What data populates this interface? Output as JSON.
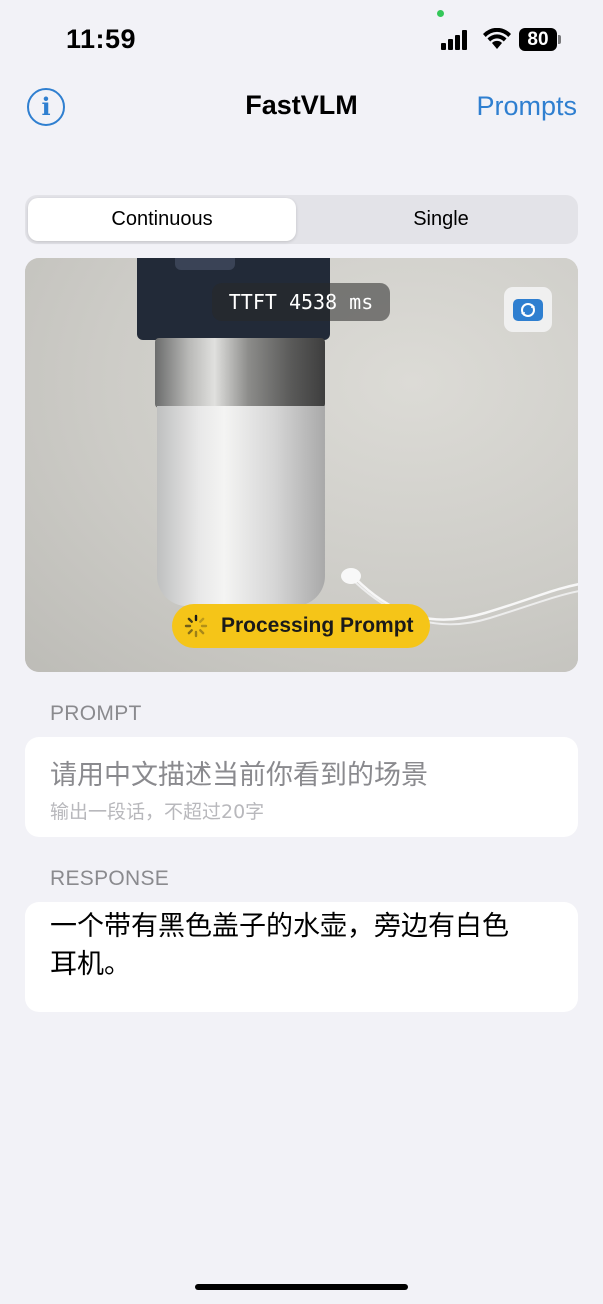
{
  "status_bar": {
    "time": "11:59",
    "battery": "80"
  },
  "nav": {
    "title": "FastVLM",
    "right_button": "Prompts",
    "left_icon": "info-icon"
  },
  "mode_segment": {
    "options": [
      "Continuous",
      "Single"
    ],
    "selected": "Continuous"
  },
  "camera": {
    "ttft_label": "TTFT 4538 ms",
    "switch_icon": "camera-rotate-icon",
    "status": "Processing Prompt"
  },
  "prompt_section": {
    "header": "PROMPT",
    "text": "请用中文描述当前你看到的场景",
    "subtext": "输出一段话，不超过20字"
  },
  "response_section": {
    "header": "RESPONSE",
    "text": "一个带有黑色盖子的水壶，旁边有白色耳机。"
  },
  "colors": {
    "accent": "#2f7fd0",
    "processing_badge": "#f5c518",
    "background": "#f2f2f7"
  }
}
